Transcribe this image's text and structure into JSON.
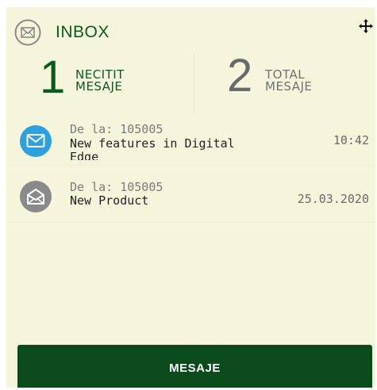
{
  "header": {
    "title": "INBOX",
    "icon": "envelope-circle-icon",
    "move_icon": "move-arrows-icon"
  },
  "stats": {
    "unread": {
      "value": "1",
      "label_line1": "NECITIT",
      "label_line2": "MESAJE"
    },
    "total": {
      "value": "2",
      "label_line1": "TOTAL",
      "label_line2": "MESAJE"
    }
  },
  "messages": [
    {
      "from": "De la: 105005",
      "subject": "New features in Digital Edge",
      "time": "10:42",
      "status": "unread",
      "icon": "envelope-closed-icon",
      "icon_color": "#2ea0e0"
    },
    {
      "from": "De la: 105005",
      "subject": "New Product",
      "time": "25.03.2020",
      "status": "read",
      "icon": "envelope-open-icon",
      "icon_color": "#8a8a8a"
    }
  ],
  "button": {
    "label": "MESAJE"
  },
  "colors": {
    "background": "#f5f5dc",
    "brand_green": "#0a5a1e",
    "button_green": "#0b4a1b",
    "unread_blue": "#2ea0e0",
    "read_gray": "#8a8a8a"
  }
}
